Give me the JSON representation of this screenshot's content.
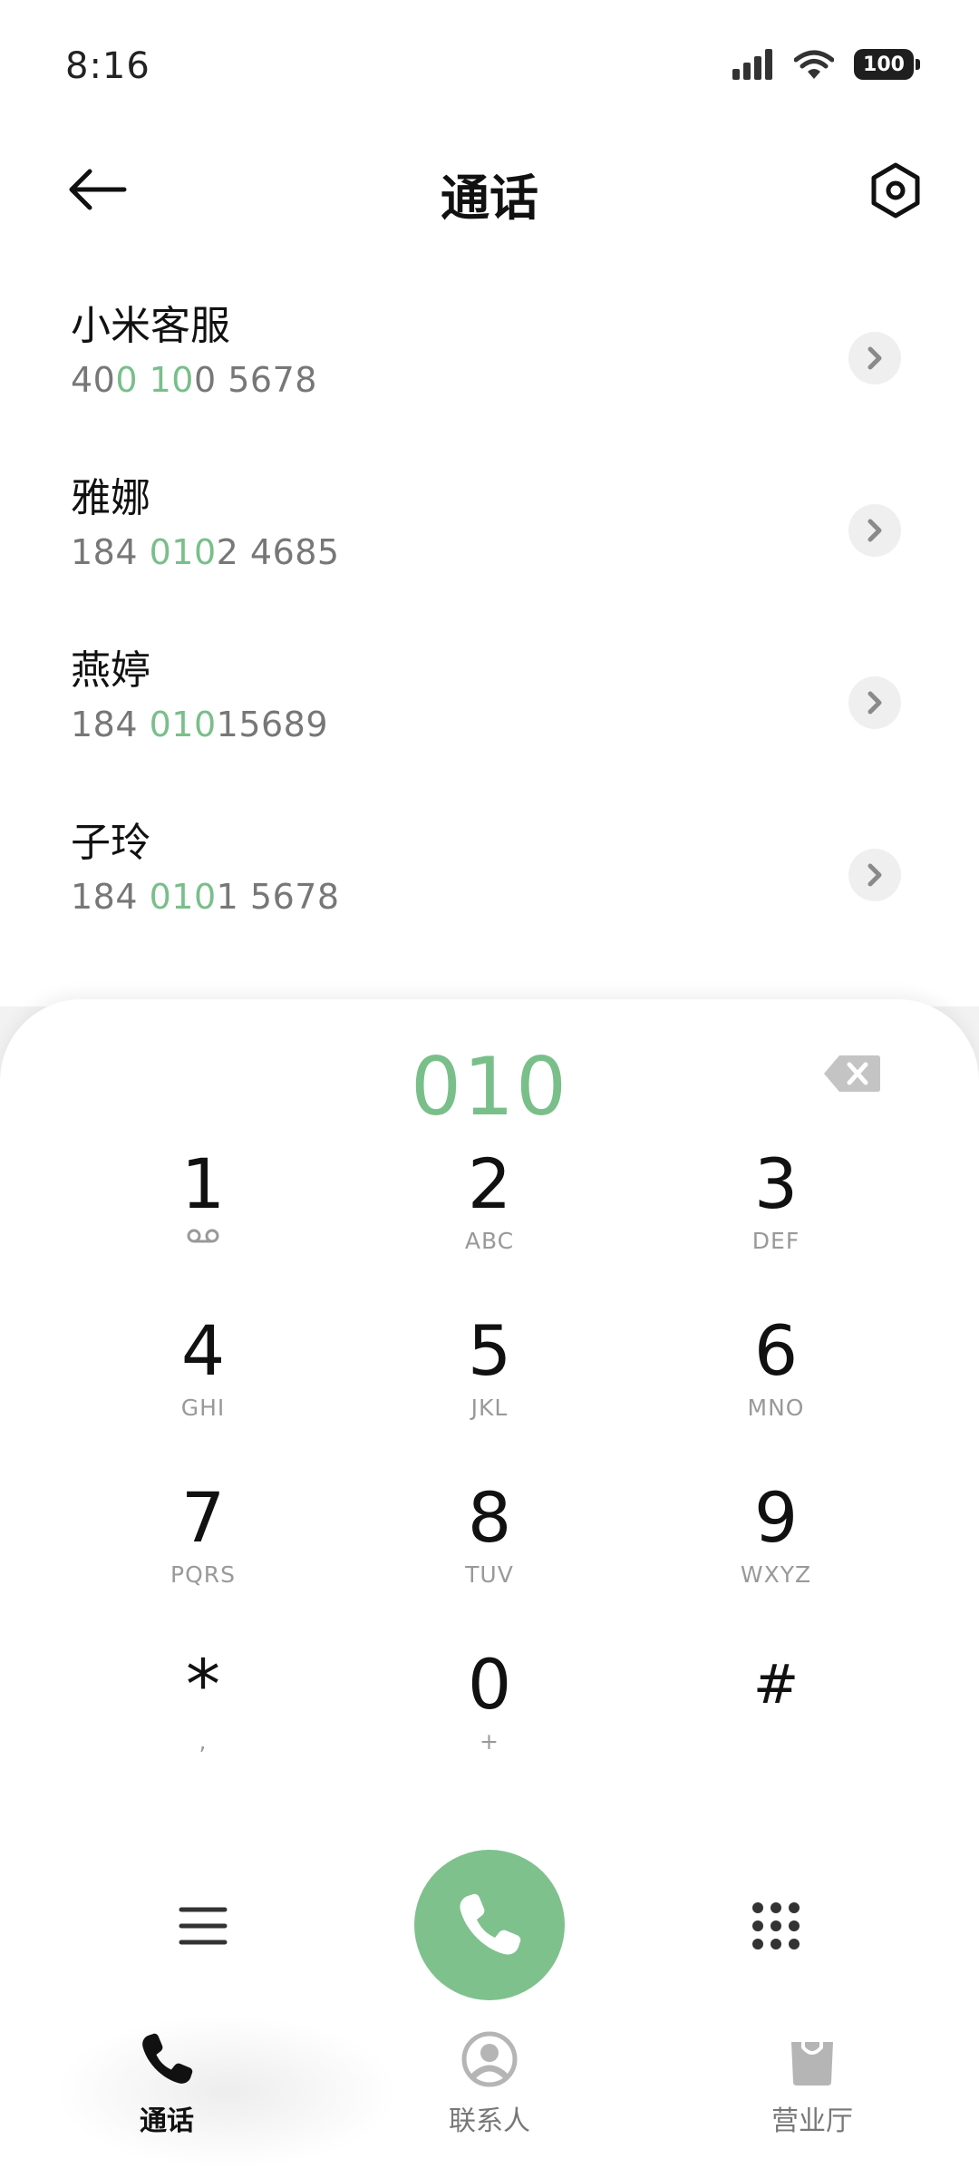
{
  "status_bar": {
    "time": "8:16",
    "battery": "100"
  },
  "header": {
    "title": "通话"
  },
  "results": [
    {
      "name": "小米客服",
      "number_parts": [
        "40",
        "0 10",
        "0 5678"
      ]
    },
    {
      "name": "雅娜",
      "number_parts": [
        "184 ",
        "010",
        "2 4685"
      ]
    },
    {
      "name": "燕婷",
      "number_parts": [
        "184 ",
        "010",
        "15689"
      ]
    },
    {
      "name": "子玲",
      "number_parts": [
        "184 ",
        "010",
        "1 5678"
      ]
    }
  ],
  "dialpad": {
    "dialed_number": "010",
    "keys": [
      {
        "digit": "1",
        "letters": ""
      },
      {
        "digit": "2",
        "letters": "ABC"
      },
      {
        "digit": "3",
        "letters": "DEF"
      },
      {
        "digit": "4",
        "letters": "GHI"
      },
      {
        "digit": "5",
        "letters": "JKL"
      },
      {
        "digit": "6",
        "letters": "MNO"
      },
      {
        "digit": "7",
        "letters": "PQRS"
      },
      {
        "digit": "8",
        "letters": "TUV"
      },
      {
        "digit": "9",
        "letters": "WXYZ"
      },
      {
        "digit": "*",
        "letters": ","
      },
      {
        "digit": "0",
        "letters": "+"
      },
      {
        "digit": "#",
        "letters": ""
      }
    ]
  },
  "bottom_nav": {
    "items": [
      {
        "label": "通话",
        "icon": "phone-icon",
        "active": true
      },
      {
        "label": "联系人",
        "icon": "contact-icon",
        "active": false
      },
      {
        "label": "营业厅",
        "icon": "shop-bag-icon",
        "active": false
      }
    ]
  },
  "colors": {
    "accent_green": "#79bf8a",
    "call_button": "#7ec18d"
  }
}
